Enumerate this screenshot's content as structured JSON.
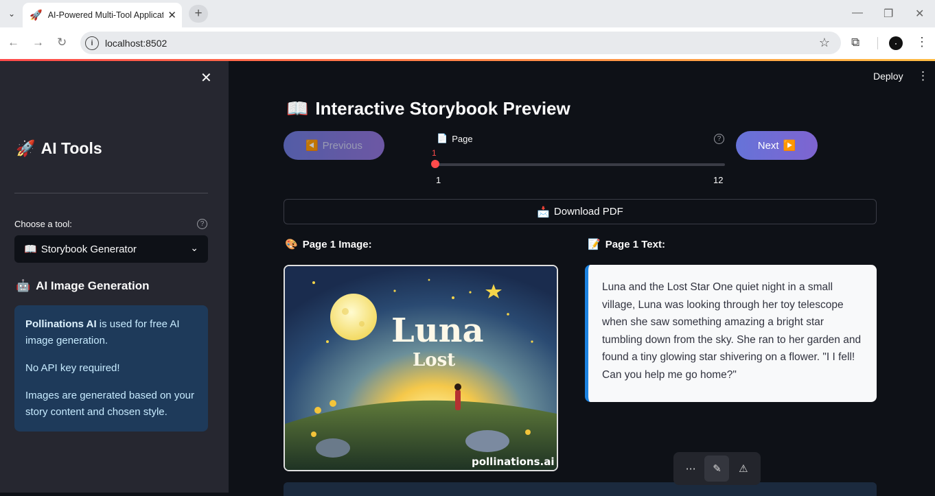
{
  "browser": {
    "tab_title": "AI-Powered Multi-Tool Applicati",
    "url": "localhost:8502"
  },
  "sidebar": {
    "heading": "AI Tools",
    "heading_icon": "🚀",
    "choose_label": "Choose a tool:",
    "selected_tool": "Storybook Generator",
    "selected_tool_icon": "📖",
    "subheading": "AI Image Generation",
    "subheading_icon": "🤖",
    "info": {
      "brand": "Pollinations AI",
      "line1_rest": " is used for free AI image generation.",
      "line2": "No API key required!",
      "line3": "Images are generated based on your story content and chosen style."
    }
  },
  "header": {
    "deploy_label": "Deploy"
  },
  "main": {
    "title": "Interactive Storybook Preview",
    "title_icon": "📖",
    "prev_label": "Previous",
    "prev_icon": "◀️",
    "next_label": "Next",
    "next_icon": "▶️",
    "slider": {
      "label": "Page",
      "label_icon": "📄",
      "value": 1,
      "min": 1,
      "max": 12
    },
    "download_label": "Download PDF",
    "download_icon": "📩",
    "image_heading": "Page 1 Image:",
    "image_heading_icon": "🎨",
    "text_heading": "Page 1 Text:",
    "text_heading_icon": "📝",
    "image": {
      "title_word1": "Luna",
      "title_word2": "Lost",
      "watermark": "pollinations.ai"
    },
    "story_text": "Luna and the Lost Star One quiet night in a small village, Luna was looking through her toy telescope when she saw something amazing a bright star tumbling down from the sky. She ran to her garden and found a tiny glowing star shivering on a flower. \"I I fell! Can you help me go home?\""
  },
  "colors": {
    "accent": "#ff4b4b",
    "button_gradient_start": "#6673d8",
    "button_gradient_end": "#7e64d0",
    "info_bg": "#1e3a5a"
  }
}
